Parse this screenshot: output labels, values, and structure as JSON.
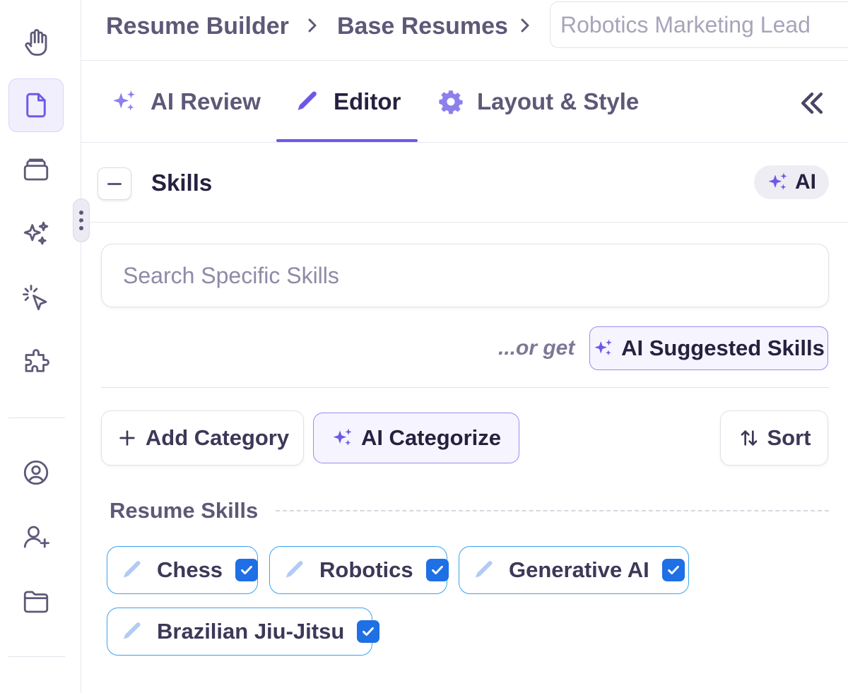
{
  "breadcrumb": {
    "items": [
      "Resume Builder",
      "Base Resumes"
    ],
    "current_placeholder": "Robotics Marketing Lead"
  },
  "sidebar": {
    "items": [
      {
        "name": "hand-icon"
      },
      {
        "name": "document-icon",
        "active": true
      },
      {
        "name": "archive-icon"
      },
      {
        "name": "sparkles-icon"
      },
      {
        "name": "click-icon"
      },
      {
        "name": "puzzle-icon"
      },
      {
        "name": "user-circle-icon"
      },
      {
        "name": "user-add-icon"
      },
      {
        "name": "folder-icon"
      }
    ]
  },
  "tabs": [
    {
      "label": "AI Review",
      "icon": "sparkles-icon"
    },
    {
      "label": "Editor",
      "icon": "pencil-icon",
      "active": true
    },
    {
      "label": "Layout & Style",
      "icon": "gear-icon"
    }
  ],
  "section": {
    "title": "Skills",
    "ai_chip": "AI"
  },
  "search": {
    "placeholder": "Search Specific Skills"
  },
  "suggest": {
    "prefix": "...or get",
    "button": "AI Suggested Skills"
  },
  "actions": {
    "add_category": "Add Category",
    "ai_categorize": "AI Categorize",
    "sort": "Sort"
  },
  "category": {
    "title": "Resume Skills",
    "skills": [
      {
        "label": "Chess",
        "checked": true
      },
      {
        "label": "Robotics",
        "checked": true
      },
      {
        "label": "Generative AI",
        "checked": true
      },
      {
        "label": "Brazilian Jiu-Jitsu",
        "checked": true
      }
    ]
  },
  "colors": {
    "accent": "#6c5ae6",
    "chip_border": "#3aa3f0",
    "checkbox": "#1f6fe5",
    "text_primary": "#25213f",
    "text_secondary": "#5e5878"
  }
}
